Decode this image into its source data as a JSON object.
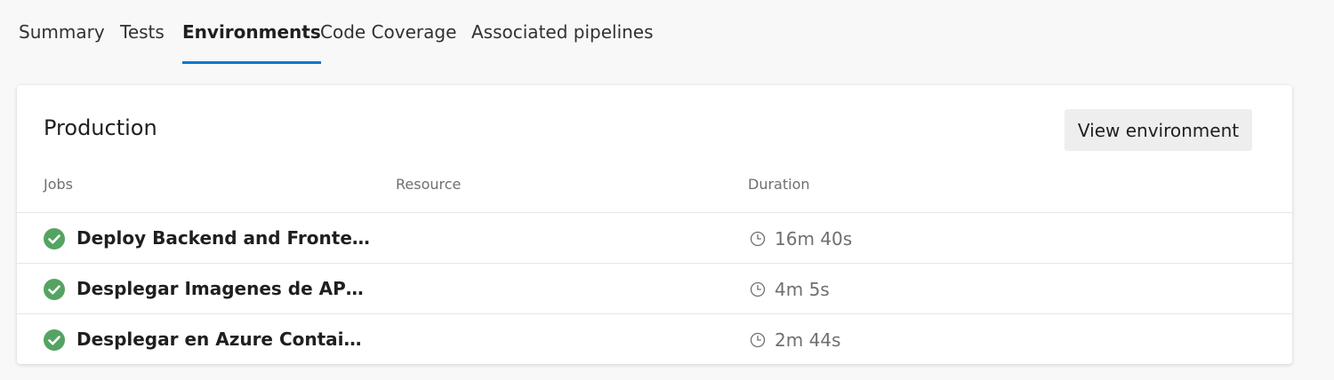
{
  "tabs": [
    {
      "label": "Summary",
      "active": false
    },
    {
      "label": "Tests",
      "active": false
    },
    {
      "label": "Environments",
      "active": true
    },
    {
      "label": "Code Coverage",
      "active": false
    },
    {
      "label": "Associated pipelines",
      "active": false
    }
  ],
  "environment": {
    "title": "Production",
    "view_button": "View environment",
    "columns": {
      "jobs": "Jobs",
      "resource": "Resource",
      "duration": "Duration"
    },
    "jobs": [
      {
        "name": "Deploy Backend and Frontend t...",
        "resource": "",
        "duration": "16m 40s",
        "status": "succeeded"
      },
      {
        "name": "Desplegar Imagenes de API y Fr...",
        "resource": "",
        "duration": "4m 5s",
        "status": "succeeded"
      },
      {
        "name": "Desplegar en Azure Container I...",
        "resource": "",
        "duration": "2m 44s",
        "status": "succeeded"
      }
    ]
  },
  "icons": {
    "status": "check-circle-icon",
    "duration": "clock-icon"
  },
  "colors": {
    "accent": "#0078d4",
    "success": "#55a362",
    "muted_text": "#6f6f6f"
  }
}
